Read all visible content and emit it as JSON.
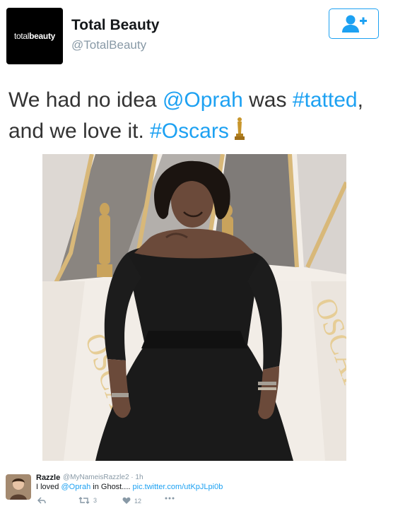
{
  "account": {
    "avatar_brand_prefix": "total",
    "avatar_brand_suffix": "beauty",
    "display_name": "Total Beauty",
    "handle": "@TotalBeauty"
  },
  "follow_button": {
    "icon": "follow-user-icon"
  },
  "tweet": {
    "text_part1": "We had no idea ",
    "mention": "@Oprah",
    "text_part2": " was ",
    "hashtag1": "#tatted",
    "text_part3": ",",
    "text_part4": "and we love it. ",
    "hashtag2": "#Oscars",
    "emoji": "oscar-statue-icon"
  },
  "photo": {
    "backdrop_text": "OSCARS"
  },
  "reply": {
    "name": "Razzle",
    "handle_time": "@MyNameisRazzle2 · 1h",
    "text_part1": "I loved ",
    "mention": "@Oprah",
    "text_part2": " in Ghost.... ",
    "link": "pic.twitter.com/utKpJLpi0b",
    "retweet_count": "3",
    "like_count": "12"
  },
  "colors": {
    "link": "#1da1f2",
    "muted": "#8899a6"
  }
}
